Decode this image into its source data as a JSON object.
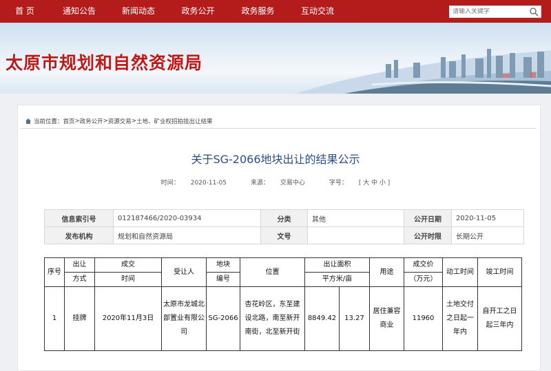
{
  "nav": [
    "首 页",
    "通知公告",
    "新闻动态",
    "政务公开",
    "政务服务",
    "互动交流"
  ],
  "search": {
    "placeholder": "请输入关键字"
  },
  "banner": {
    "title": "太原市规划和自然资源局"
  },
  "breadcrumb": {
    "prefix": "当前位置：",
    "items": [
      "首页",
      "政务公开",
      "资源交易",
      "土地、矿业权招拍挂出让结果"
    ],
    "sep": " > "
  },
  "article": {
    "title": "关于SG-2066地块出让的结果公示",
    "time_label": "时间：",
    "time": "2020-11-05",
    "source_label": "来源：",
    "source": "交易中心",
    "size_label": "字号：",
    "size_options": "[ 大 中 小 ]"
  },
  "info": {
    "index_label": "信息索引号",
    "index": "012187466/2020-03934",
    "category_label": "分类",
    "category": "其他",
    "date_label": "公开日期",
    "date": "2020-11-05",
    "org_label": "发布机构",
    "org": "规划和自然资源局",
    "docno_label": "文号",
    "docno": "",
    "period_label": "公开时限",
    "period": "长期公开"
  },
  "result": {
    "headers": {
      "seq": "序号",
      "method1": "出让",
      "method2": "方式",
      "time1": "成交",
      "time2": "时间",
      "assignee": "受让人",
      "plot1": "地块",
      "plot2": "编号",
      "location": "位置",
      "area1": "出让面积",
      "area2": "平方米/亩",
      "use": "用途",
      "price1": "成交价",
      "price2": "（万元）",
      "start": "动工时间",
      "finish": "竣工时间"
    },
    "row": {
      "seq": "1",
      "method": "挂牌",
      "time": "2020年11月3日",
      "assignee": "太原市龙城北部置业有限公司",
      "plot": "SG-2066",
      "location": "杏花岭区，东至建设北路，南至新开南街，北至新开街",
      "area_m2": "8849.42",
      "area_mu": "13.27",
      "use": "居住兼容商业",
      "price": "11960",
      "start": "土地交付之日起一年内",
      "finish": "自开工之日起三年内"
    }
  },
  "colors": {
    "nav_bg": "#b41c1c",
    "banner_title": "#c01818",
    "article_title": "#2a4e86"
  }
}
